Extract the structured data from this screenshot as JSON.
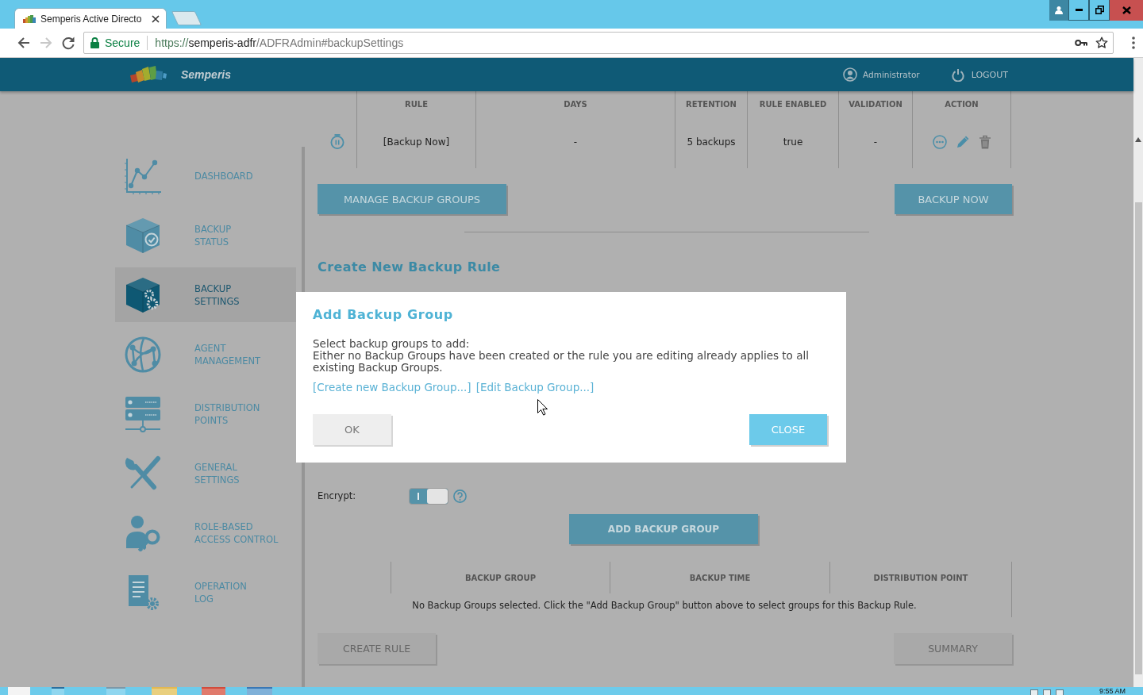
{
  "browser": {
    "tab": {
      "title": "Semperis Active Directo"
    },
    "navigation": {
      "forward_disabled": true
    },
    "address_bar": {
      "security_label": "Secure",
      "url_parts": [
        "https://",
        "semperis-adfr",
        "/ADFRAdmin#backupSettings"
      ]
    }
  },
  "app_header": {
    "brand": "Semperis",
    "user": "Administrator",
    "logout": "LOGOUT"
  },
  "sidebar": {
    "items": [
      {
        "label": "DASHBOARD",
        "selected": false
      },
      {
        "label": "BACKUP\nSTATUS",
        "selected": false
      },
      {
        "label": "BACKUP\nSETTINGS",
        "selected": true
      },
      {
        "label": "AGENT\nMANAGEMENT",
        "selected": false
      },
      {
        "label": "DISTRIBUTION\nPOINTS",
        "selected": false
      },
      {
        "label": "GENERAL\nSETTINGS",
        "selected": false
      },
      {
        "label": "ROLE-BASED\nACCESS CONTROL",
        "selected": false
      },
      {
        "label": "OPERATION\nLOG",
        "selected": false
      }
    ]
  },
  "rules_table": {
    "columns": [
      "RULE",
      "DAYS",
      "RETENTION",
      "RULE ENABLED",
      "VALIDATION",
      "ACTION"
    ],
    "rows": [
      {
        "cells": [
          "[Backup Now]",
          "-",
          "5 backups",
          "true",
          "-"
        ]
      }
    ]
  },
  "rule_buttons": [
    "MANAGE BACKUP GROUPS",
    "BACKUP NOW"
  ],
  "create_rule": {
    "title": "Create New Backup Rule",
    "fields": [
      {
        "kind": "toggle",
        "label": "Encrypt:",
        "on": true
      }
    ],
    "add_button": "ADD BACKUP GROUP",
    "groups_table": {
      "columns": [
        "BACKUP GROUP",
        "BACKUP TIME",
        "DISTRIBUTION POINT"
      ],
      "empty_message": "No Backup Groups selected. Click the \"Add Backup Group\" button above to select groups for this Backup Rule."
    },
    "buttons": [
      "CREATE RULE",
      "SUMMARY"
    ]
  },
  "dialog": {
    "title": "Add Backup Group",
    "paragraphs": [
      "Select backup groups to add:",
      "Either no Backup Groups have been created or the rule you are editing already applies to all existing Backup Groups."
    ],
    "links": [
      "[Create new Backup Group...]",
      "[Edit Backup Group...]"
    ],
    "buttons": [
      {
        "label": "OK",
        "kind": "secondary"
      },
      {
        "label": "CLOSE",
        "kind": "primary"
      }
    ]
  },
  "taskbar": {
    "clock": "9:55 AM"
  }
}
